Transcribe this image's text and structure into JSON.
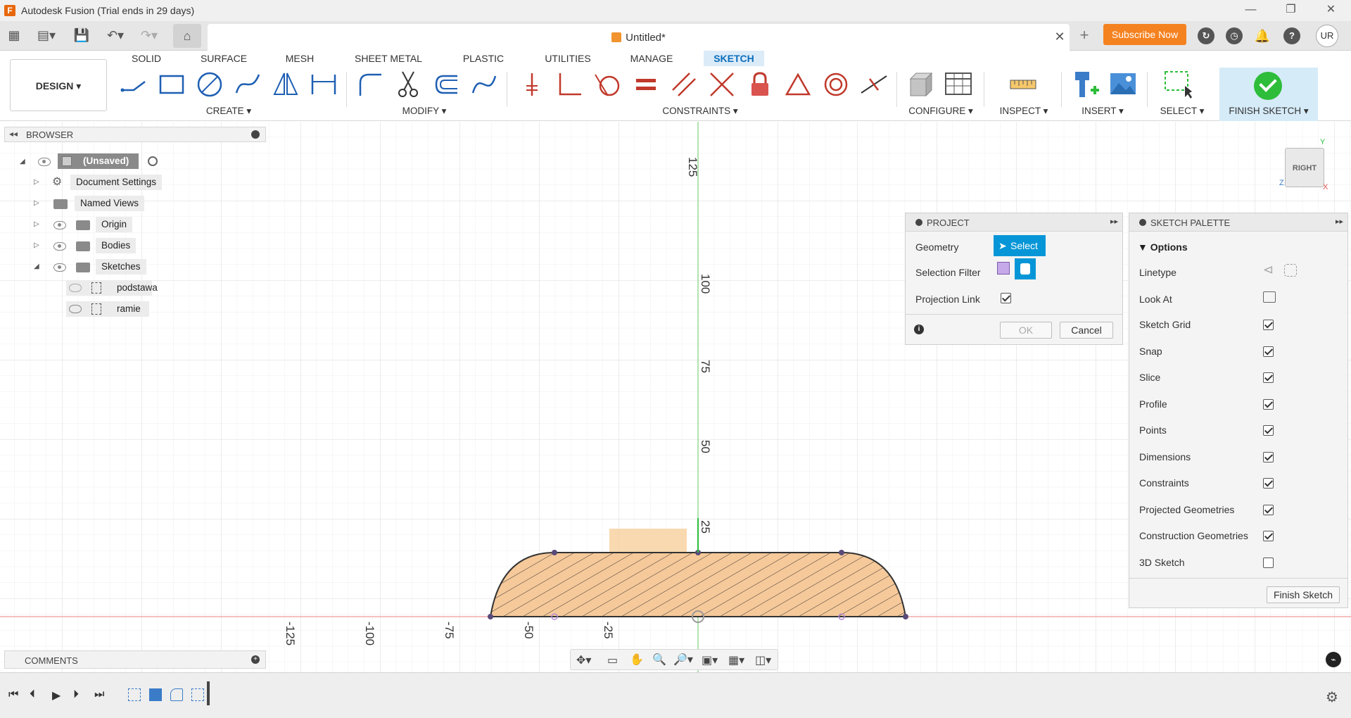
{
  "window": {
    "title": "Autodesk Fusion (Trial ends in 29 days)",
    "controls": [
      "—",
      "❐",
      "✕"
    ]
  },
  "tabbar": {
    "document_title": "Untitled*",
    "close_glyph": "✕",
    "new_tab_glyph": "+",
    "subscribe_label": "Subscribe Now",
    "avatar_initials": "UR"
  },
  "toolbar": {
    "design_label": "DESIGN ▾",
    "workspace_tabs": [
      "SOLID",
      "SURFACE",
      "MESH",
      "SHEET METAL",
      "PLASTIC",
      "UTILITIES",
      "MANAGE",
      "SKETCH"
    ],
    "active_tab": "SKETCH",
    "groups": {
      "create": "CREATE ▾",
      "modify": "MODIFY ▾",
      "constraints": "CONSTRAINTS ▾",
      "configure": "CONFIGURE ▾",
      "inspect": "INSPECT ▾",
      "insert": "INSERT ▾",
      "select": "SELECT ▾",
      "finish": "FINISH SKETCH ▾"
    }
  },
  "browser": {
    "title": "BROWSER",
    "root": "(Unsaved)",
    "items": [
      {
        "label": "Document Settings"
      },
      {
        "label": "Named Views"
      },
      {
        "label": "Origin"
      },
      {
        "label": "Bodies"
      },
      {
        "label": "Sketches"
      }
    ],
    "sketches": [
      {
        "label": "podstawa"
      },
      {
        "label": "ramie"
      }
    ]
  },
  "canvas": {
    "vertical_ticks": [
      "125",
      "100",
      "75",
      "50",
      "25"
    ],
    "horizontal_ticks": [
      "-125",
      "-100",
      "-75",
      "-50",
      "-25"
    ],
    "viewcube_label": "RIGHT",
    "axis_y": "Y",
    "axis_z": "Z",
    "axis_x": "X"
  },
  "project_panel": {
    "title": "PROJECT",
    "geometry_label": "Geometry",
    "select_label": "Select",
    "selection_filter_label": "Selection Filter",
    "projection_link_label": "Projection Link",
    "ok_label": "OK",
    "cancel_label": "Cancel"
  },
  "sketch_palette": {
    "title": "SKETCH PALETTE",
    "section": "Options",
    "linetype_label": "Linetype",
    "look_at_label": "Look At",
    "options": [
      {
        "label": "Sketch Grid",
        "checked": true
      },
      {
        "label": "Snap",
        "checked": true
      },
      {
        "label": "Slice",
        "checked": true
      },
      {
        "label": "Profile",
        "checked": true
      },
      {
        "label": "Points",
        "checked": true
      },
      {
        "label": "Dimensions",
        "checked": true
      },
      {
        "label": "Constraints",
        "checked": true
      },
      {
        "label": "Projected Geometries",
        "checked": true
      },
      {
        "label": "Construction Geometries",
        "checked": true
      },
      {
        "label": "3D Sketch",
        "checked": false
      }
    ],
    "finish_label": "Finish Sketch"
  },
  "comments": {
    "title": "COMMENTS"
  },
  "colors": {
    "accent": "#0696d7",
    "subscribe": "#f58220",
    "profile_fill": "#f6c99a",
    "finish_green": "#2dbd3a"
  }
}
